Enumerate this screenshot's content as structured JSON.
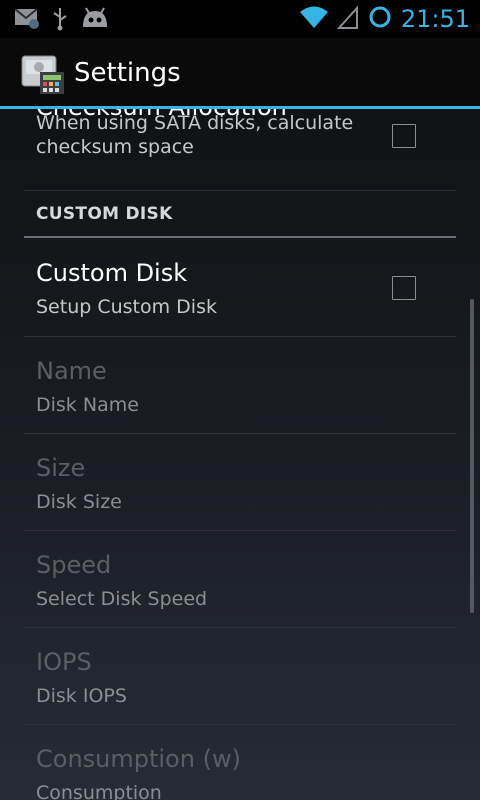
{
  "status_bar": {
    "time": "21:51",
    "icons": [
      "gmail-icon",
      "usb-icon",
      "android-debug-icon",
      "wifi-icon",
      "signal-icon",
      "sync-ring-icon"
    ]
  },
  "action_bar": {
    "title": "Settings",
    "icon": "disk-calculator-app-icon"
  },
  "preferences": {
    "checksum": {
      "title": "Checksum Allocation",
      "summary_line1": "When using SATA disks, calculate",
      "summary_line2": "checksum space",
      "checked": false
    },
    "category_title": "CUSTOM DISK",
    "custom_disk": {
      "title": "Custom Disk",
      "summary": "Setup Custom Disk",
      "checked": false
    },
    "name": {
      "title": "Name",
      "summary": "Disk Name",
      "enabled": false
    },
    "size": {
      "title": "Size",
      "summary": "Disk Size",
      "enabled": false
    },
    "speed": {
      "title": "Speed",
      "summary": "Select Disk Speed",
      "enabled": false
    },
    "iops": {
      "title": "IOPS",
      "summary": "Disk IOPS",
      "enabled": false
    },
    "consumption": {
      "title": "Consumption (w)",
      "summary": "Consumption",
      "enabled": false
    }
  },
  "colors": {
    "accent": "#33b5e5",
    "background": "#000000"
  }
}
